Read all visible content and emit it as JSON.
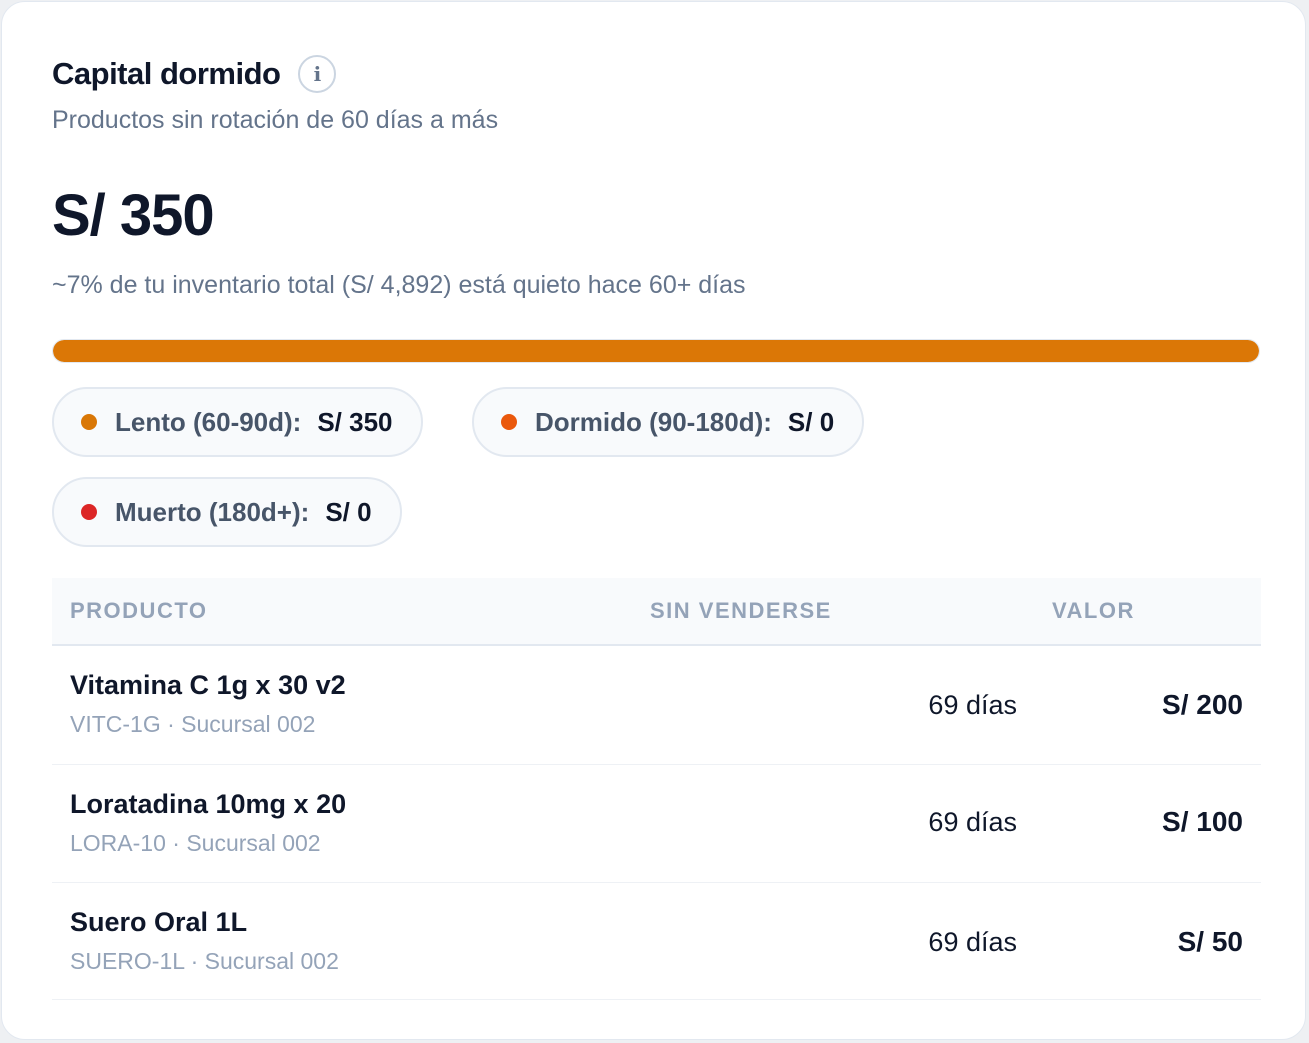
{
  "card": {
    "title": "Capital dormido",
    "info_icon": "i",
    "subtitle": "Productos sin rotación de 60 días a más",
    "total_value": "S/ 350",
    "summary": "~7% de tu inventario total (S/ 4,892) está quieto hace 60+ días",
    "progress_percent": 100,
    "progress_color": "#db7706"
  },
  "buckets": [
    {
      "label": "Lento (60-90d):",
      "value": "S/ 350",
      "color": "#d97706"
    },
    {
      "label": "Dormido (90-180d):",
      "value": "S/ 0",
      "color": "#ea580c"
    },
    {
      "label": "Muerto (180d+):",
      "value": "S/ 0",
      "color": "#dc2626"
    }
  ],
  "table": {
    "headers": {
      "product": "PRODUCTO",
      "days": "SIN VENDERSE",
      "value": "VALOR"
    },
    "rows": [
      {
        "name": "Vitamina C 1g x 30 v2",
        "sub": "VITC-1G · Sucursal 002",
        "days": "69 días",
        "value": "S/ 200"
      },
      {
        "name": "Loratadina 10mg x 20",
        "sub": "LORA-10 · Sucursal 002",
        "days": "69 días",
        "value": "S/ 100"
      },
      {
        "name": "Suero Oral 1L",
        "sub": "SUERO-1L · Sucursal 002",
        "days": "69 días",
        "value": "S/ 50"
      }
    ]
  }
}
